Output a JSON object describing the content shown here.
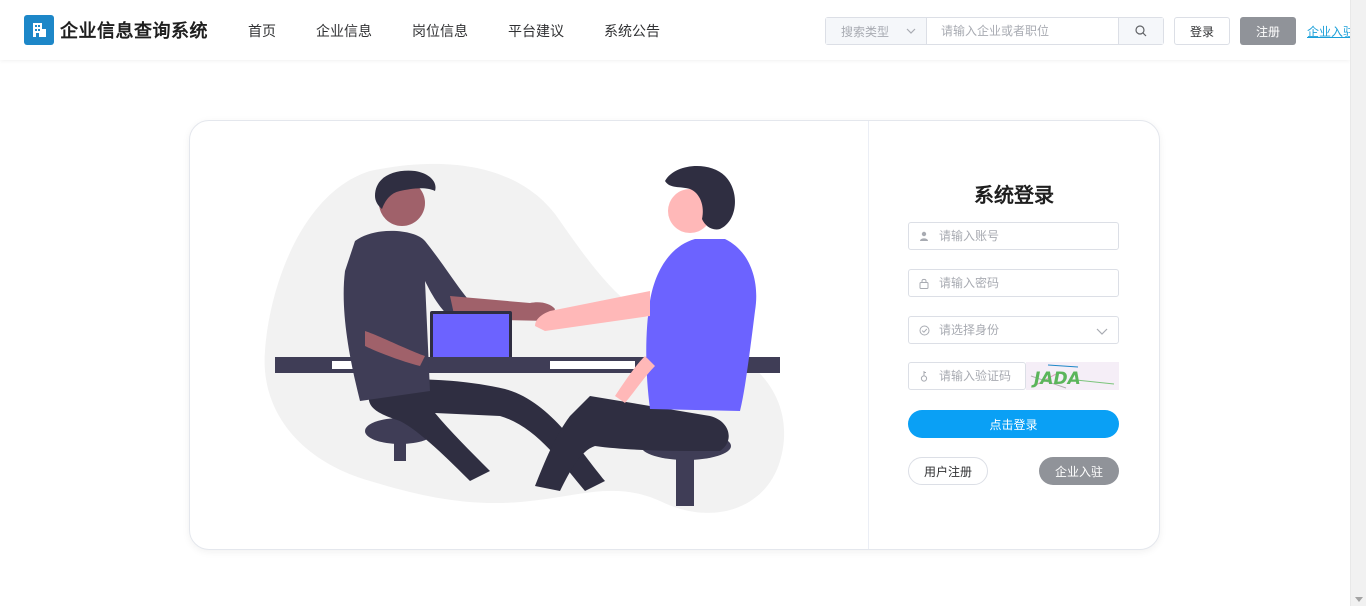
{
  "header": {
    "app_title": "企业信息查询系统",
    "nav": [
      {
        "label": "首页"
      },
      {
        "label": "企业信息"
      },
      {
        "label": "岗位信息"
      },
      {
        "label": "平台建议"
      },
      {
        "label": "系统公告"
      }
    ],
    "search": {
      "type_placeholder": "搜索类型",
      "input_placeholder": "请输入企业或者职位",
      "icon": "search-icon"
    },
    "login_label": "登录",
    "register_label": "注册",
    "enterprise_join_link": "企业入驻"
  },
  "login_form": {
    "title": "系统登录",
    "account_placeholder": "请输入账号",
    "password_placeholder": "请输入密码",
    "role_placeholder": "请选择身份",
    "captcha_placeholder": "请输入验证码",
    "captcha_text": "JADA",
    "submit_label": "点击登录",
    "user_register_label": "用户注册",
    "enterprise_join_label": "企业入驻"
  },
  "colors": {
    "brand": "#1d87c8",
    "primary_button": "#0aa0f5",
    "secondary_button": "#909399",
    "link": "#1a9fd9",
    "illustration_accent": "#6c63ff",
    "illustration_dark": "#2f2e41"
  }
}
